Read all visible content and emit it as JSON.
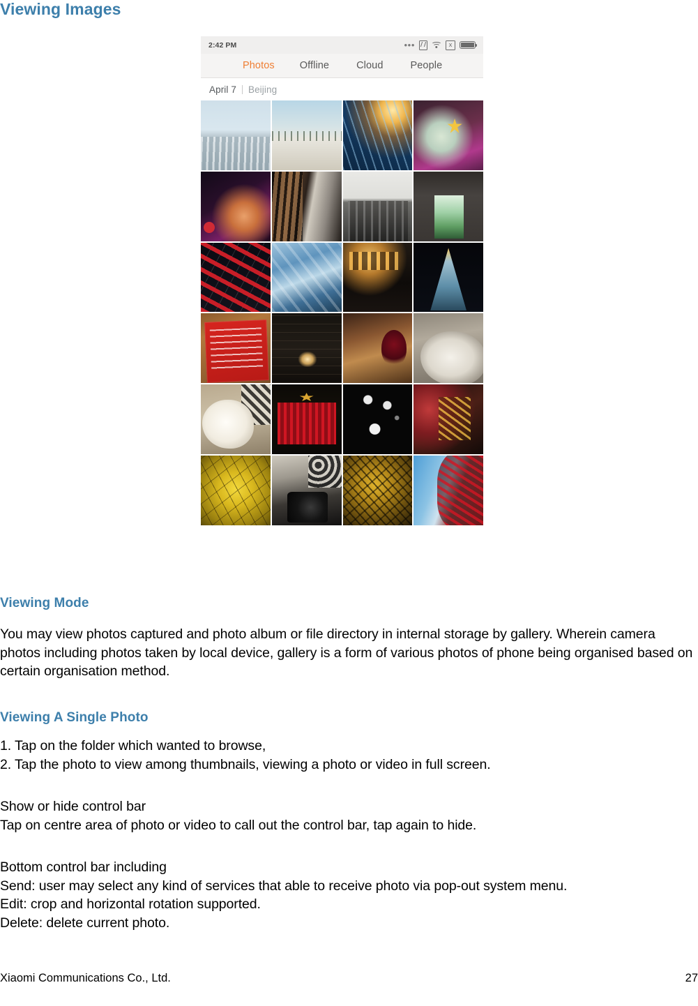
{
  "page": {
    "heading": "Viewing Images"
  },
  "phone": {
    "status_bar": {
      "time": "2:42 PM",
      "icons": [
        "ellipsis-icon",
        "nfc-icon",
        "wifi-icon",
        "no-sim-icon",
        "battery-icon"
      ],
      "no_sim_glyph": "x"
    },
    "tabs": [
      {
        "label": "Photos",
        "active": true
      },
      {
        "label": "Offline",
        "active": false
      },
      {
        "label": "Cloud",
        "active": false
      },
      {
        "label": "People",
        "active": false
      }
    ],
    "active_tab_color": "#ef7e33",
    "section": {
      "date": "April 7",
      "location": "Beijing"
    },
    "grid": {
      "columns": 4,
      "photos": [
        {
          "name": "snow-field-horizon",
          "art": "p-snowfield1"
        },
        {
          "name": "snow-field-treeline",
          "art": "p-snowfield2"
        },
        {
          "name": "railway-tracks-sunset",
          "art": "p-railway"
        },
        {
          "name": "bear-plush-with-star",
          "art": "p-bearlight"
        },
        {
          "name": "concert-crowd-neon",
          "art": "p-concert"
        },
        {
          "name": "wooden-staircase-banister",
          "art": "p-stairs"
        },
        {
          "name": "old-building-monochrome",
          "art": "p-building"
        },
        {
          "name": "arched-doorway-mural",
          "art": "p-arch"
        },
        {
          "name": "red-lanterns-night",
          "art": "p-lanterns"
        },
        {
          "name": "blue-ice-sculpture",
          "art": "p-ice"
        },
        {
          "name": "bar-interior-lights",
          "art": "p-bar"
        },
        {
          "name": "christmas-tree-lights",
          "art": "p-xmastree"
        },
        {
          "name": "xiaomi-dinner-invitation",
          "art": "p-redcard"
        },
        {
          "name": "brick-wall-lamp",
          "art": "p-brick"
        },
        {
          "name": "wine-glass-dessert-table",
          "art": "p-wine"
        },
        {
          "name": "white-dog-portrait",
          "art": "p-dog"
        },
        {
          "name": "sleeping-white-cat",
          "art": "p-cat"
        },
        {
          "name": "red-theatre-curtain",
          "art": "p-theatre"
        },
        {
          "name": "dark-room-bright-windows",
          "art": "p-darkroom"
        },
        {
          "name": "gold-ornament-red-drape",
          "art": "p-gold"
        },
        {
          "name": "yellow-ginkgo-canopy",
          "art": "p-ginkgo"
        },
        {
          "name": "vintage-camera-still-life",
          "art": "p-camera"
        },
        {
          "name": "autumn-golden-foliage",
          "art": "p-autumn"
        },
        {
          "name": "red-leaves-blue-sky",
          "art": "p-redleaf"
        }
      ]
    }
  },
  "sections": {
    "viewing_mode": {
      "heading": "Viewing Mode",
      "body": "You may view photos captured and photo album or file directory in internal storage by gallery. Wherein camera photos including photos taken by local device, gallery is a form of various photos of phone being organised based on certain organisation method."
    },
    "viewing_single_photo": {
      "heading": "Viewing A Single Photo",
      "steps_line1": "1. Tap on the folder which wanted to browse,",
      "steps_line2": "2. Tap the photo to view among thumbnails, viewing a photo or video in full screen.",
      "control_bar_line1": "Show or hide control bar",
      "control_bar_line2": "Tap on centre area of photo or video to call out the control bar, tap again to hide.",
      "bottom_bar_line1": "Bottom control bar including",
      "bottom_bar_line2": "Send: user may select any kind of services that able to receive photo via pop-out system menu.",
      "bottom_bar_line3": "Edit: crop and horizontal rotation supported.",
      "bottom_bar_line4": "Delete: delete current photo."
    }
  },
  "footer": {
    "company": "Xiaomi Communications Co., Ltd.",
    "page_number": "27"
  },
  "colors": {
    "heading_blue": "#3d7fab",
    "tab_active_orange": "#ef7e33"
  }
}
